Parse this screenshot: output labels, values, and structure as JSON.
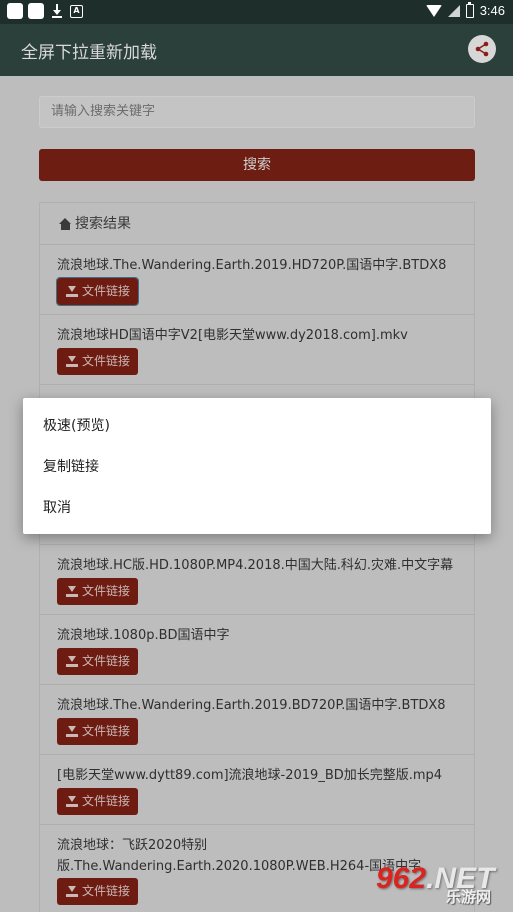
{
  "status_bar": {
    "time": "3:46",
    "left_icons": [
      "app-icon",
      "app-icon",
      "download-icon",
      "a-icon"
    ],
    "right_icons": [
      "wifi-icon",
      "cellular-icon",
      "battery-icon"
    ]
  },
  "app_bar": {
    "title": "全屏下拉重新加载",
    "share_icon": "share-icon"
  },
  "search": {
    "placeholder": "请输入搜索关键字",
    "button_label": "搜索"
  },
  "results": {
    "header": "搜索结果",
    "link_label": "文件链接",
    "items": [
      {
        "title": "流浪地球.The.Wandering.Earth.2019.HD720P.国语中字.BTDX8"
      },
      {
        "title": "流浪地球HD国语中字V2[电影天堂www.dy2018.com].mkv"
      },
      {
        "title": ""
      },
      {
        "title": "流浪地球.HC版.HD.1080P.MP4.2018.中国大陆.科幻.灾难.中文字幕"
      },
      {
        "title": "流浪地球.1080p.BD国语中字"
      },
      {
        "title": "流浪地球.The.Wandering.Earth.2019.BD720P.国语中字.BTDX8"
      },
      {
        "title": "[电影天堂www.dytt89.com]流浪地球-2019_BD加长完整版.mp4"
      },
      {
        "title": "流浪地球：飞跃2020特别版.The.Wandering.Earth.2020.1080P.WEB.H264-国语中字"
      }
    ]
  },
  "dialog": {
    "options": [
      "极速(预览)",
      "复制链接",
      "取消"
    ]
  },
  "watermark": {
    "number": "962",
    "suffix": ".NET",
    "subtitle": "乐游网"
  },
  "colors": {
    "app_bar": "#2b3f3b",
    "button_red": "#c0392b",
    "dialog_bg": "#ffffff"
  }
}
